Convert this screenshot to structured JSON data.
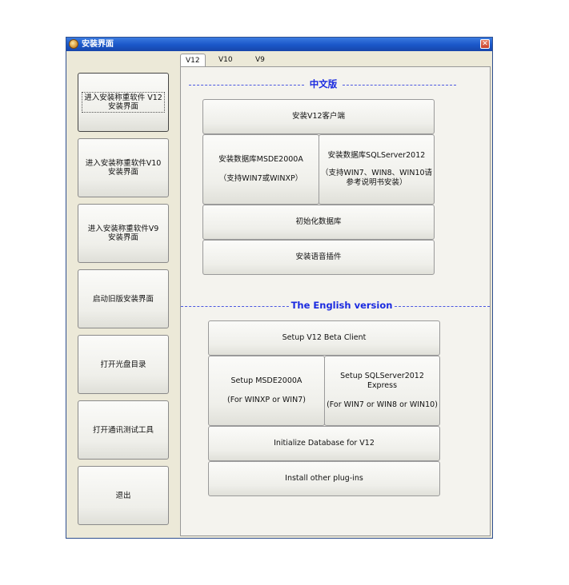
{
  "window": {
    "title": "安装界面"
  },
  "tabs": [
    "V12",
    "V10",
    "V9"
  ],
  "sidebar": {
    "items": [
      {
        "label": "进入安装称重软件 V12\n安装界面"
      },
      {
        "label": "进入安装称重软件V10\n安装界面"
      },
      {
        "label": "进入安装称重软件V9\n安装界面"
      },
      {
        "label": "启动旧版安装界面"
      },
      {
        "label": "打开光盘目录"
      },
      {
        "label": "打开通讯测试工具"
      },
      {
        "label": "退出"
      }
    ]
  },
  "chinese": {
    "section_title": "中文版",
    "client_button": "安装V12客户端",
    "msde_button": {
      "line1": "安装数据库MSDE2000A",
      "line2": "（支持WIN7或WINXP）"
    },
    "sql_button": {
      "line1": "安装数据库SQLServer2012",
      "line2": "（支持WIN7、WIN8、WIN10请\n参考说明书安装）"
    },
    "init_button": "初始化数据库",
    "voice_button": "安装语音插件"
  },
  "english": {
    "section_title": "The English version",
    "client_button": "Setup V12 Beta Client",
    "msde_button": {
      "line1": "Setup MSDE2000A",
      "line2": "(For WINXP or WIN7)"
    },
    "sql_button": {
      "line1": "Setup SQLServer2012 Express",
      "line2": "(For WIN7 or WIN8 or WIN10)"
    },
    "init_button": "Initialize Database for V12",
    "plugins_button": "Install other plug-ins"
  },
  "colors": {
    "section_title": "#1a2ae0",
    "titlebar": "#1a56c8",
    "window_bg": "#ece9d8"
  }
}
